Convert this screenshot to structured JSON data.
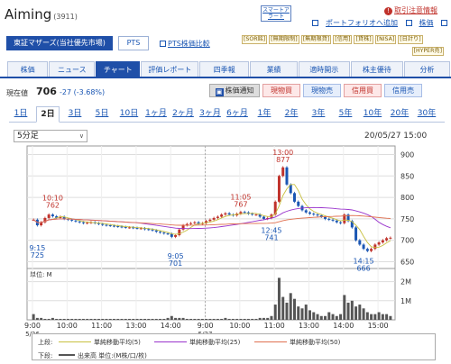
{
  "header": {
    "company": "Aiming",
    "code": "(3911)",
    "smart_alert": "スマートアラート",
    "attention": "取引注意情報",
    "portfolio": "ポートフォリオへ追加",
    "price_link": "株価",
    "all_board": "全板"
  },
  "market": {
    "label": "東証マザーズ(当社優先市場)",
    "pts": "PTS",
    "pts_compare": "PTS株価比較"
  },
  "badges": {
    "row1": [
      "SOR銘",
      "無期限制",
      "無期限貸",
      "信用",
      "貸株",
      "NISA",
      "日計り"
    ],
    "row2": [
      "HYPER売"
    ]
  },
  "tabs": [
    "株価",
    "ニュース",
    "チャート",
    "評価レポート",
    "四季報",
    "業績",
    "適時開示",
    "株主優待",
    "分析"
  ],
  "active_tab": "チャート",
  "quote": {
    "label": "現在値",
    "price": "706",
    "change": "-27 (-3.68%)"
  },
  "actions": {
    "notify": "株価通知",
    "cash_buy": "現物買",
    "cash_sell": "現物売",
    "margin_buy": "信用買",
    "margin_sell": "信用売"
  },
  "periods": [
    "1日",
    "2日",
    "3日",
    "5日",
    "10日",
    "1ヶ月",
    "2ヶ月",
    "3ヶ月",
    "6ヶ月",
    "1年",
    "2年",
    "3年",
    "5年",
    "10年",
    "20年",
    "30年"
  ],
  "active_period": "2日",
  "interval": "5分足",
  "timestamp": "20/05/27 15:00",
  "colors": {
    "accent": "#1f4fa8",
    "up": "#c0322b",
    "down": "#1a56b3",
    "ma5": "#c8c040",
    "ma25": "#9933cc",
    "ma50": "#e07050",
    "volume": "#555555"
  },
  "chart_data": {
    "type": "candlestick",
    "x_ticks": [
      "9:00",
      "10:00",
      "11:00",
      "13:00",
      "14:00",
      "9:00",
      "10:00",
      "11:00",
      "13:00",
      "14:00",
      "15:00"
    ],
    "date_labels": [
      "5/26",
      "5/27"
    ],
    "y_ticks": [
      900,
      850,
      800,
      750,
      700,
      650
    ],
    "ylim": [
      630,
      920
    ],
    "volume_ticks": [
      "2M",
      "1M"
    ],
    "volume_label": "単位: M",
    "annotations": [
      {
        "time": "10:10",
        "value": "762"
      },
      {
        "time": "9:15",
        "value": "725"
      },
      {
        "time": "9:05",
        "value": "701"
      },
      {
        "time": "11:05",
        "value": "767"
      },
      {
        "time": "12:45",
        "value": "741"
      },
      {
        "time": "13:00",
        "value": "877"
      },
      {
        "time": "14:15",
        "value": "666"
      }
    ],
    "price_series": [
      748,
      735,
      742,
      752,
      760,
      756,
      752,
      755,
      750,
      748,
      746,
      744,
      742,
      740,
      741,
      742,
      740,
      738,
      736,
      735,
      734,
      733,
      732,
      731,
      730,
      730,
      729,
      728,
      728,
      726,
      725,
      723,
      720,
      718,
      716,
      715,
      708,
      712,
      725,
      735,
      738,
      740,
      742,
      738,
      740,
      745,
      748,
      752,
      755,
      760,
      763,
      760,
      758,
      762,
      766,
      765,
      762,
      760,
      760,
      755,
      750,
      752,
      760,
      790,
      850,
      870,
      830,
      810,
      790,
      780,
      770,
      765,
      762,
      760,
      758,
      755,
      750,
      748,
      746,
      742,
      740,
      760,
      745,
      730,
      700,
      690,
      680,
      675,
      680,
      690,
      695,
      700,
      705,
      706
    ],
    "volume_series": [
      0.3,
      0.1,
      0.1,
      0.05,
      0.05,
      0.1,
      0.05,
      0.05,
      0.05,
      0.05,
      0.05,
      0.05,
      0.05,
      0.05,
      0.05,
      0.05,
      0.05,
      0.05,
      0.05,
      0.05,
      0.05,
      0.05,
      0.05,
      0.05,
      0.05,
      0.05,
      0.05,
      0.05,
      0.05,
      0.05,
      0.05,
      0.05,
      0.05,
      0.05,
      0.05,
      0.1,
      0.2,
      0.1,
      0.1,
      0.1,
      0.05,
      0.05,
      0.05,
      0.05,
      0.05,
      0.05,
      0.05,
      0.05,
      0.05,
      0.05,
      0.1,
      0.05,
      0.05,
      0.05,
      0.05,
      0.05,
      0.05,
      0.05,
      0.05,
      0.1,
      0.1,
      0.1,
      0.2,
      0.8,
      2.2,
      1.2,
      0.9,
      1.4,
      1.1,
      0.7,
      0.6,
      0.8,
      0.5,
      0.4,
      0.3,
      0.2,
      0.2,
      0.4,
      0.3,
      0.2,
      0.3,
      1.3,
      0.9,
      1.0,
      0.7,
      0.8,
      0.6,
      0.4,
      0.3,
      0.3,
      0.4,
      0.3,
      0.3,
      0.2
    ],
    "legend": {
      "row1_label": "上段:",
      "ma5": "単純移動平均(5)",
      "ma25": "単純移動平均(25)",
      "ma50": "単純移動平均(50)",
      "row2_label": "下段:",
      "volume": "出来高 単位:(M株/口/枚)"
    }
  }
}
